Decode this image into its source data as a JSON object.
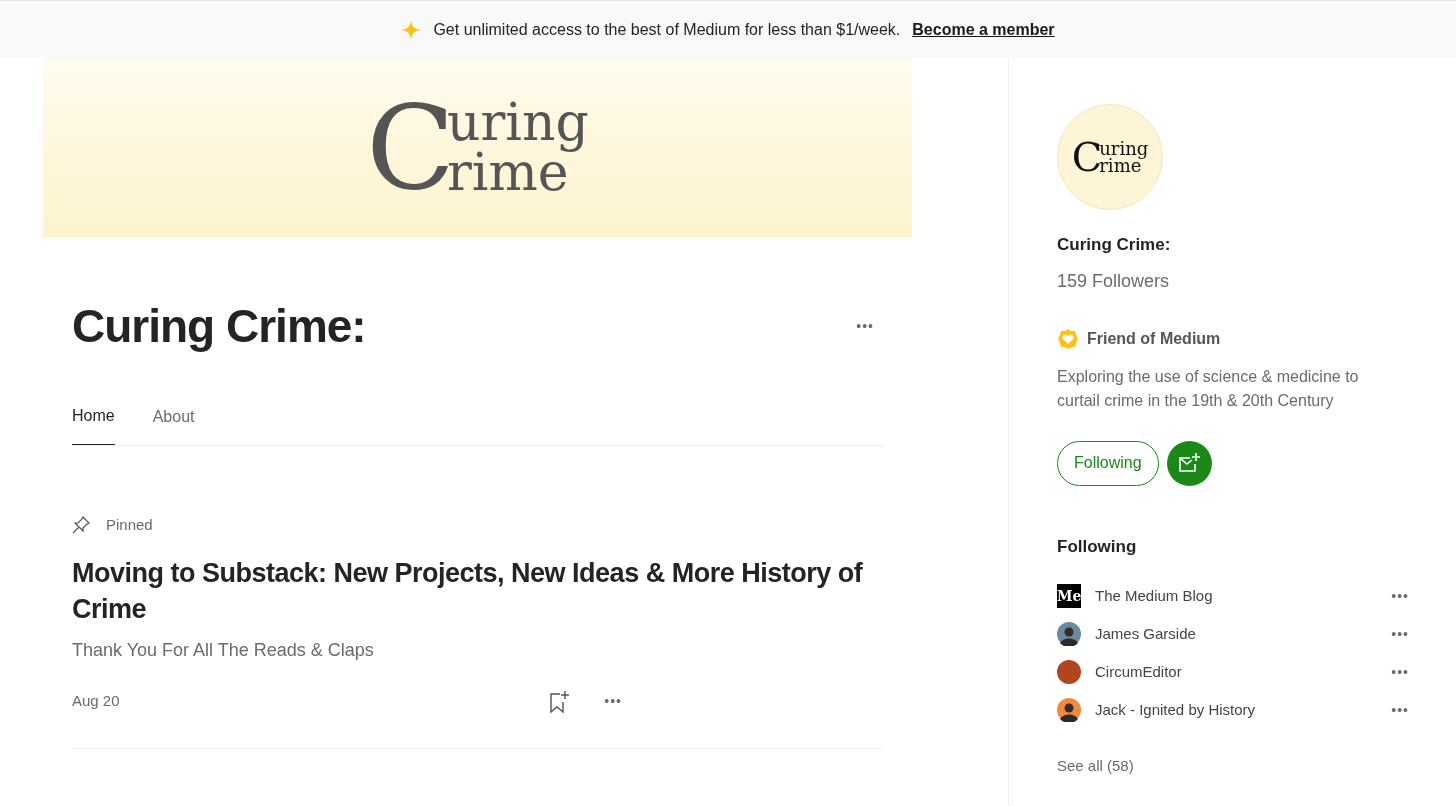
{
  "promo_bar": {
    "text": "Get unlimited access to the best of Medium for less than $1/week.",
    "link": "Become a member"
  },
  "banner": {
    "logo_lines": [
      "uring",
      "rime"
    ],
    "logo_initial": "C"
  },
  "publication": {
    "title": "Curing Crime:",
    "more": "•••"
  },
  "tabs": [
    {
      "label": "Home",
      "selected": true
    },
    {
      "label": "About",
      "selected": false
    }
  ],
  "pinned_post": {
    "pin_label": "Pinned",
    "title": "Moving to Substack: New Projects, New Ideas & More History of Crime",
    "subtitle": "Thank You For All The Reads & Claps",
    "date": "Aug 20",
    "more": "•••"
  },
  "sidebar": {
    "avatar": {
      "logo_initial": "C",
      "logo_lines": [
        "uring",
        "rime"
      ]
    },
    "name": "Curing Crime:",
    "followers": "159 Followers",
    "badge": "Friend of Medium",
    "bio": "Exploring the use of science & medicine to curtail crime in the 19th & 20th Century",
    "follow_button": "Following",
    "following_heading": "Following",
    "following": [
      {
        "name": "The Medium Blog",
        "kind": "logo",
        "avatar_text": "Me",
        "more": "•••"
      },
      {
        "name": "James Garside",
        "kind": "person",
        "color": "#6a8aa0",
        "more": "•••"
      },
      {
        "name": "CircumEditor",
        "kind": "disc",
        "color": "#b0461f",
        "more": "•••"
      },
      {
        "name": "Jack - Ignited by History",
        "kind": "person",
        "color": "#f08a3c",
        "more": "•••"
      }
    ],
    "see_all": "See all (58)"
  }
}
